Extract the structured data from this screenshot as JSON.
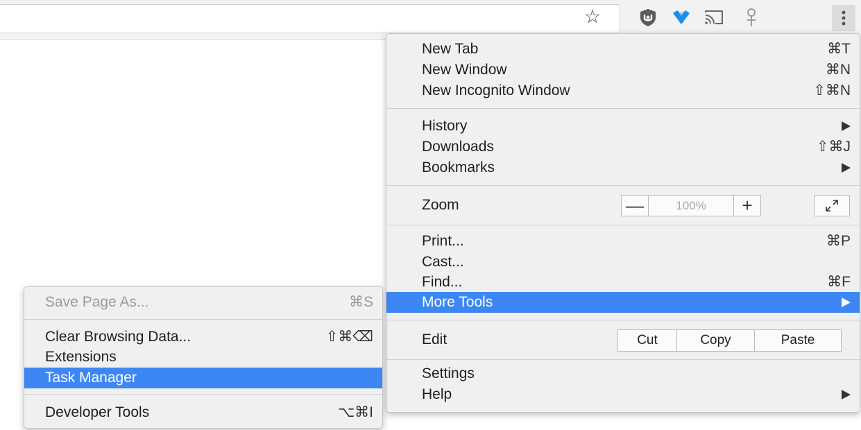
{
  "toolbar": {
    "icons": [
      "star-icon",
      "ublock-shield-icon",
      "heart-extension-icon",
      "cast-icon",
      "pin-extension-icon",
      "chrome-menu-icon"
    ],
    "star_glyph": "☆",
    "brand_blue": "#1a8fe3",
    "shield_color": "#5a5a5a"
  },
  "main_menu": {
    "new_tab": {
      "label": "New Tab",
      "shortcut": "⌘T"
    },
    "new_window": {
      "label": "New Window",
      "shortcut": "⌘N"
    },
    "new_incognito": {
      "label": "New Incognito Window",
      "shortcut": "⇧⌘N"
    },
    "history": {
      "label": "History"
    },
    "downloads": {
      "label": "Downloads",
      "shortcut": "⇧⌘J"
    },
    "bookmarks": {
      "label": "Bookmarks"
    },
    "zoom": {
      "label": "Zoom",
      "minus": "—",
      "value": "100%",
      "plus": "+"
    },
    "print": {
      "label": "Print...",
      "shortcut": "⌘P"
    },
    "cast": {
      "label": "Cast..."
    },
    "find": {
      "label": "Find...",
      "shortcut": "⌘F"
    },
    "more_tools": {
      "label": "More Tools"
    },
    "edit": {
      "label": "Edit",
      "cut": "Cut",
      "copy": "Copy",
      "paste": "Paste"
    },
    "settings": {
      "label": "Settings"
    },
    "help": {
      "label": "Help"
    }
  },
  "sub_menu": {
    "save_page": {
      "label": "Save Page As...",
      "shortcut": "⌘S"
    },
    "clear_data": {
      "label": "Clear Browsing Data...",
      "shortcut": "⇧⌘⌫"
    },
    "extensions": {
      "label": "Extensions"
    },
    "task_manager": {
      "label": "Task Manager"
    },
    "developer_tools": {
      "label": "Developer Tools",
      "shortcut": "⌥⌘I"
    }
  },
  "colors": {
    "highlight": "#3d87f4",
    "menu_bg": "#f0f0f0"
  }
}
